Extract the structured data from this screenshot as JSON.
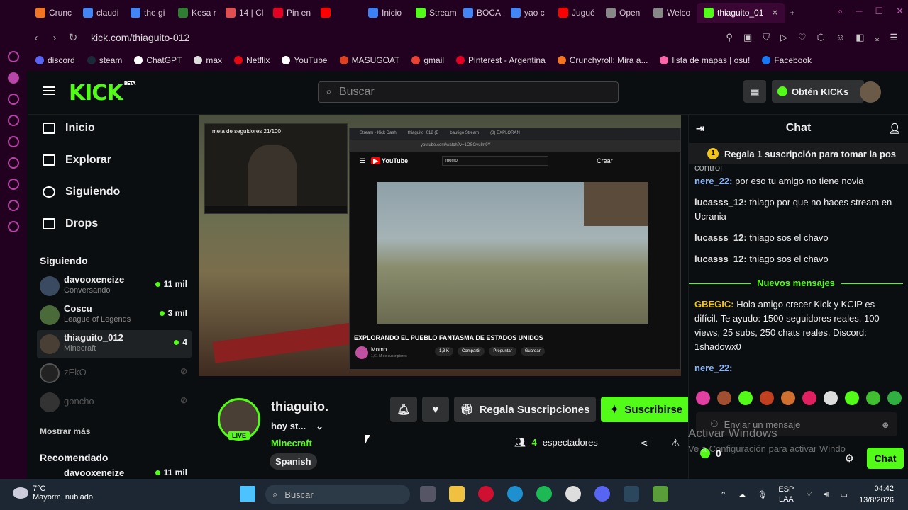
{
  "browser": {
    "tabs": [
      {
        "label": "Crunc",
        "color": "#f47521"
      },
      {
        "label": "claudi",
        "color": "#4285f4"
      },
      {
        "label": "the gi",
        "color": "#4285f4"
      },
      {
        "label": "Kesa r",
        "color": "#2e7d32"
      },
      {
        "label": "14 | Cl",
        "color": "#e05050"
      },
      {
        "label": "Pin en",
        "color": "#e60023"
      },
      {
        "label": "",
        "color": "#ff0000"
      },
      {
        "label": "Inicio",
        "color": "#3b82f6"
      },
      {
        "label": "Stream",
        "color": "#53fc18"
      },
      {
        "label": "BOCA",
        "color": "#4285f4"
      },
      {
        "label": "yao c",
        "color": "#4285f4"
      },
      {
        "label": "Jugué",
        "color": "#ff0000"
      },
      {
        "label": "Open",
        "color": "#888888"
      },
      {
        "label": "Welco",
        "color": "#888888"
      }
    ],
    "active_tab": "thiaguito_01",
    "url": "kick.com/thiaguito-012",
    "bookmarks": [
      {
        "label": "discord",
        "color": "#5865f2"
      },
      {
        "label": "steam",
        "color": "#1b2838"
      },
      {
        "label": "ChatGPT",
        "color": "#ffffff"
      },
      {
        "label": "max",
        "color": "#dddddd"
      },
      {
        "label": "Netflix",
        "color": "#e50914"
      },
      {
        "label": "YouTube",
        "color": "#ffffff"
      },
      {
        "label": "MASUGOAT",
        "color": "#e04020"
      },
      {
        "label": "gmail",
        "color": "#ea4335"
      },
      {
        "label": "Pinterest - Argentina",
        "color": "#e60023"
      },
      {
        "label": "Crunchyroll: Mira a...",
        "color": "#f47521"
      },
      {
        "label": "lista de mapas | osu!",
        "color": "#ff66aa"
      },
      {
        "label": "Facebook",
        "color": "#1877f2"
      }
    ]
  },
  "kick": {
    "logo": "KICK",
    "logo_badge": "BETA",
    "search_placeholder": "Buscar",
    "get_kicks": "Obtén KICKs",
    "nav": [
      "Inicio",
      "Explorar",
      "Siguiendo",
      "Drops"
    ],
    "following_title": "Siguiendo",
    "following": [
      {
        "name": "davooxeneize",
        "game": "Conversando",
        "viewers": "11 mil",
        "color": "#3a4a60"
      },
      {
        "name": "Coscu",
        "game": "League of Legends",
        "viewers": "3 mil",
        "color": "#4a6a3a"
      },
      {
        "name": "thiaguito_012",
        "game": "Minecraft",
        "viewers": "4",
        "color": "#4a3f35"
      }
    ],
    "offline": [
      "zEkO",
      "goncho"
    ],
    "show_more": "Mostrar más",
    "recommended_title": "Recomendado",
    "recommended_partial": "davooxeneize",
    "recommended_partial_viewers": "11 mil"
  },
  "video": {
    "cam_title": "meta de seguidores 21/100",
    "inner_tabs": [
      "Stream - Kick Dash",
      "thiaguito_012 (B",
      "bautigo Stream",
      "(8) EXPLORAN"
    ],
    "inner_url": "youtube.com/watch?v=1OSGyuIm9Y",
    "yt_search": "momo",
    "yt_create": "Crear",
    "yt_title": "EXPLORANDO EL PUEBLO FANTASMA DE ESTADOS UNIDOS",
    "yt_channel": "Momo",
    "yt_subs": "1,61 M de suscriptores",
    "yt_actions": [
      "1,3 K",
      "Compartir",
      "Preguntar",
      "Guardar"
    ]
  },
  "stream": {
    "name": "thiaguito.",
    "title": "hoy st...",
    "category": "Minecraft",
    "language": "Spanish",
    "live": "LIVE",
    "gift_label": "Regala Suscripciones",
    "subscribe_label": "Suscribirse",
    "viewers_count": "4",
    "viewers_label": "espectadores"
  },
  "chat": {
    "title": "Chat",
    "pinned": "Regala 1 suscripción para tomar la pos",
    "partial_top": "control",
    "messages": [
      {
        "user": "nere_22",
        "color": "#8ab4f8",
        "text": "por eso tu amigo no tiene novia"
      },
      {
        "user": "lucasss_12",
        "color": "#e0e0e0",
        "text": "thiago por que no haces stream en Ucrania"
      },
      {
        "user": "lucasss_12",
        "color": "#e0e0e0",
        "text": "thiago sos el chavo"
      },
      {
        "user": "lucasss_12",
        "color": "#e0e0e0",
        "text": "thiago sos el chavo"
      }
    ],
    "new_messages": "Nuevos mensajes",
    "messages_after": [
      {
        "user": "GBEGIC",
        "color": "#f0c419",
        "text": "Hola amigo crecer Kick y KCIP es difícil. Te ayudo: 1500 seguidores reales, 100 views, 25 subs, 250 chats reales. Discord: 1shadowx0"
      },
      {
        "user": "nere_22",
        "color": "#8ab4f8",
        "text": ""
      }
    ],
    "input_placeholder": "Enviar un mensaje",
    "kicks_balance": "0",
    "chat_button": "Chat"
  },
  "windows_watermark": {
    "line1": "Activar Windows",
    "line2": "Ve a Configuración para activar Windo"
  },
  "taskbar": {
    "temp": "7°C",
    "weather": "Mayorm. nublado",
    "search": "Buscar",
    "lang1": "ESP",
    "lang2": "LAA",
    "time": "04:42",
    "date": "13/8/2026"
  }
}
